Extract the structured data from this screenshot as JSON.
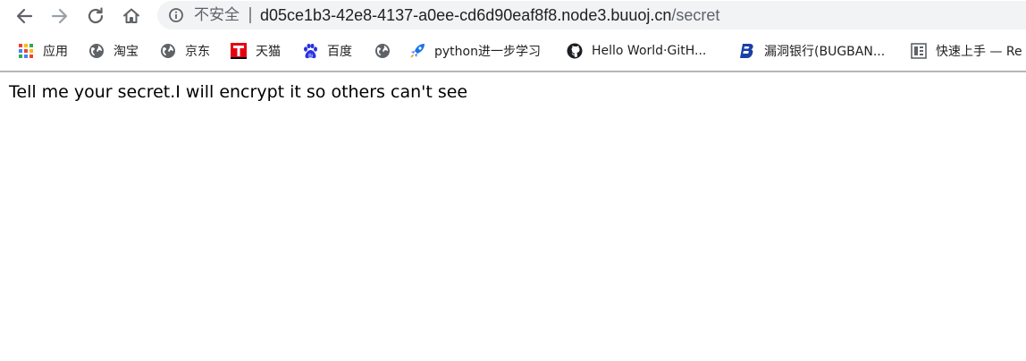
{
  "toolbar": {
    "back_icon": "arrow-left-icon",
    "forward_icon": "arrow-right-icon",
    "reload_icon": "reload-icon",
    "home_icon": "home-icon",
    "colors": {
      "icon": "#5f6368",
      "disabled": "#9aa0a6",
      "omnibox_bg": "#f1f3f4"
    }
  },
  "address_bar": {
    "info_icon": "info-icon",
    "security_label": "不安全",
    "host": "d05ce1b3-42e8-4137-a0ee-cd6d90eaf8f8.node3.buuoj.cn",
    "path": "/secret"
  },
  "bookmarks": [
    {
      "label": "应用",
      "icon": "apps-grid-icon"
    },
    {
      "label": "淘宝",
      "icon": "globe-icon"
    },
    {
      "label": "京东",
      "icon": "globe-icon"
    },
    {
      "label": "天猫",
      "icon": "tmall-icon"
    },
    {
      "label": "百度",
      "icon": "baidu-paw-icon"
    },
    {
      "label": "",
      "icon": "globe-icon"
    },
    {
      "label": "python进一步学习",
      "icon": "rocket-icon"
    },
    {
      "label": "Hello World·GitH...",
      "icon": "github-icon"
    },
    {
      "label": "漏洞银行(BUGBAN...",
      "icon": "bugbank-icon"
    },
    {
      "label": "快速上手 — Re",
      "icon": "book-icon"
    }
  ],
  "page": {
    "message": "Tell me your secret.I will encrypt it so others can't see"
  }
}
